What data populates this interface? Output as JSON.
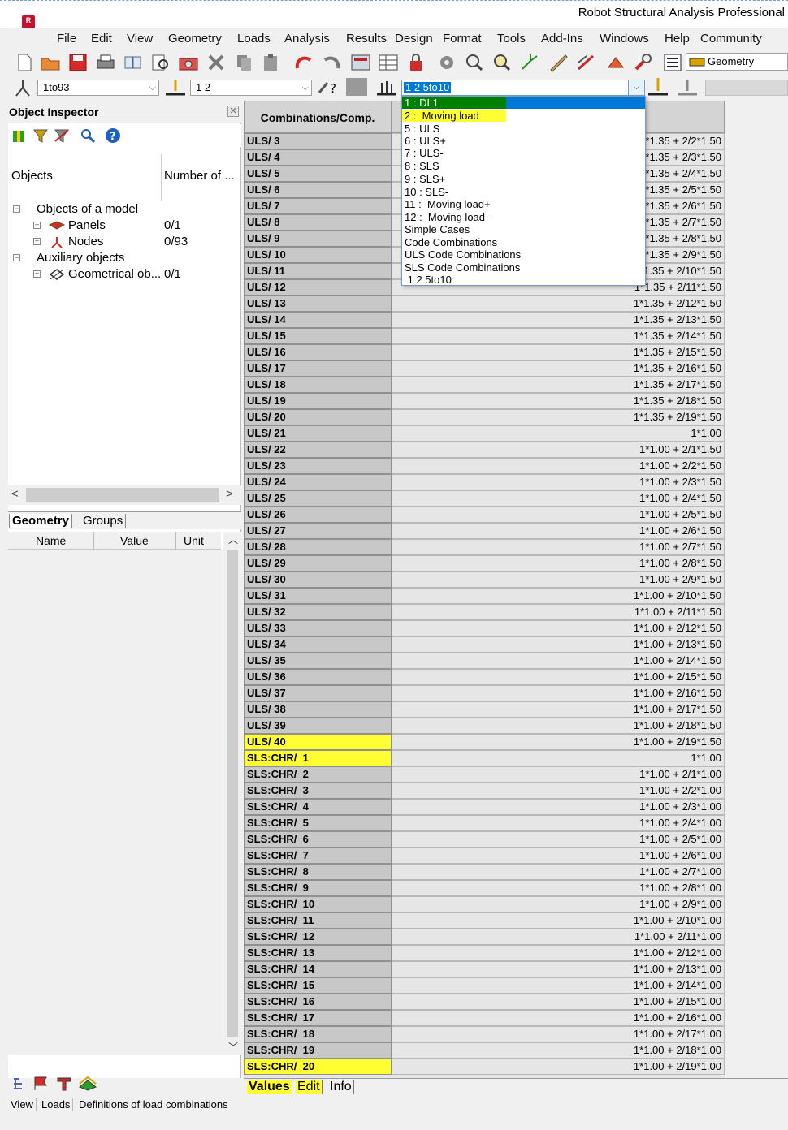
{
  "window": {
    "title": "Robot Structural Analysis Professional"
  },
  "menu": [
    "File",
    "Edit",
    "View",
    "Geometry",
    "Loads",
    "Analysis",
    "Results",
    "Design",
    "Format",
    "Tools",
    "Add-Ins",
    "Windows",
    "Help",
    "Community"
  ],
  "toolbar": {
    "layout_label": "Geometry"
  },
  "selectors": {
    "nodes_value": "1to93",
    "cases_value": "1 2",
    "combo_value": "1 2 5to10"
  },
  "inspector": {
    "title": "Object Inspector",
    "col_objects": "Objects",
    "col_number": "Number of ...",
    "tree": {
      "root": "Objects of a model",
      "panels": "Panels",
      "panels_count": "0/1",
      "nodes": "Nodes",
      "nodes_count": "0/93",
      "aux": "Auxiliary objects",
      "geom": "Geometrical ob...",
      "geom_count": "0/1"
    },
    "tabs": [
      "Geometry",
      "Groups"
    ],
    "props_cols": [
      "Name",
      "Value",
      "Unit"
    ]
  },
  "status": {
    "view": "View",
    "loads": "Loads",
    "message": "Definitions of load combinations"
  },
  "table": {
    "header": "Combinations/Comp.",
    "rows": [
      {
        "name": "ULS/ 3",
        "def": "1*1.35 + 2/2*1.50"
      },
      {
        "name": "ULS/ 4",
        "def": "1*1.35 + 2/3*1.50"
      },
      {
        "name": "ULS/ 5",
        "def": "1*1.35 + 2/4*1.50"
      },
      {
        "name": "ULS/ 6",
        "def": "1*1.35 + 2/5*1.50"
      },
      {
        "name": "ULS/ 7",
        "def": "1*1.35 + 2/6*1.50"
      },
      {
        "name": "ULS/ 8",
        "def": "1*1.35 + 2/7*1.50"
      },
      {
        "name": "ULS/ 9",
        "def": "1*1.35 + 2/8*1.50"
      },
      {
        "name": "ULS/ 10",
        "def": "1*1.35 + 2/9*1.50"
      },
      {
        "name": "ULS/ 11",
        "def": "1*1.35 + 2/10*1.50"
      },
      {
        "name": "ULS/ 12",
        "def": "1*1.35 + 2/11*1.50"
      },
      {
        "name": "ULS/ 13",
        "def": "1*1.35 + 2/12*1.50"
      },
      {
        "name": "ULS/ 14",
        "def": "1*1.35 + 2/13*1.50"
      },
      {
        "name": "ULS/ 15",
        "def": "1*1.35 + 2/14*1.50"
      },
      {
        "name": "ULS/ 16",
        "def": "1*1.35 + 2/15*1.50"
      },
      {
        "name": "ULS/ 17",
        "def": "1*1.35 + 2/16*1.50"
      },
      {
        "name": "ULS/ 18",
        "def": "1*1.35 + 2/17*1.50"
      },
      {
        "name": "ULS/ 19",
        "def": "1*1.35 + 2/18*1.50"
      },
      {
        "name": "ULS/ 20",
        "def": "1*1.35 + 2/19*1.50"
      },
      {
        "name": "ULS/ 21",
        "def": "1*1.00"
      },
      {
        "name": "ULS/ 22",
        "def": "1*1.00 + 2/1*1.50"
      },
      {
        "name": "ULS/ 23",
        "def": "1*1.00 + 2/2*1.50"
      },
      {
        "name": "ULS/ 24",
        "def": "1*1.00 + 2/3*1.50"
      },
      {
        "name": "ULS/ 25",
        "def": "1*1.00 + 2/4*1.50"
      },
      {
        "name": "ULS/ 26",
        "def": "1*1.00 + 2/5*1.50"
      },
      {
        "name": "ULS/ 27",
        "def": "1*1.00 + 2/6*1.50"
      },
      {
        "name": "ULS/ 28",
        "def": "1*1.00 + 2/7*1.50"
      },
      {
        "name": "ULS/ 29",
        "def": "1*1.00 + 2/8*1.50"
      },
      {
        "name": "ULS/ 30",
        "def": "1*1.00 + 2/9*1.50"
      },
      {
        "name": "ULS/ 31",
        "def": "1*1.00 + 2/10*1.50"
      },
      {
        "name": "ULS/ 32",
        "def": "1*1.00 + 2/11*1.50"
      },
      {
        "name": "ULS/ 33",
        "def": "1*1.00 + 2/12*1.50"
      },
      {
        "name": "ULS/ 34",
        "def": "1*1.00 + 2/13*1.50"
      },
      {
        "name": "ULS/ 35",
        "def": "1*1.00 + 2/14*1.50"
      },
      {
        "name": "ULS/ 36",
        "def": "1*1.00 + 2/15*1.50"
      },
      {
        "name": "ULS/ 37",
        "def": "1*1.00 + 2/16*1.50"
      },
      {
        "name": "ULS/ 38",
        "def": "1*1.00 + 2/17*1.50"
      },
      {
        "name": "ULS/ 39",
        "def": "1*1.00 + 2/18*1.50"
      },
      {
        "name": "ULS/ 40",
        "def": "1*1.00 + 2/19*1.50",
        "highlight": true
      },
      {
        "name": "SLS:CHR/  1",
        "def": "1*1.00",
        "highlight": true
      },
      {
        "name": "SLS:CHR/  2",
        "def": "1*1.00 + 2/1*1.00"
      },
      {
        "name": "SLS:CHR/  3",
        "def": "1*1.00 + 2/2*1.00"
      },
      {
        "name": "SLS:CHR/  4",
        "def": "1*1.00 + 2/3*1.00"
      },
      {
        "name": "SLS:CHR/  5",
        "def": "1*1.00 + 2/4*1.00"
      },
      {
        "name": "SLS:CHR/  6",
        "def": "1*1.00 + 2/5*1.00"
      },
      {
        "name": "SLS:CHR/  7",
        "def": "1*1.00 + 2/6*1.00"
      },
      {
        "name": "SLS:CHR/  8",
        "def": "1*1.00 + 2/7*1.00"
      },
      {
        "name": "SLS:CHR/  9",
        "def": "1*1.00 + 2/8*1.00"
      },
      {
        "name": "SLS:CHR/  10",
        "def": "1*1.00 + 2/9*1.00"
      },
      {
        "name": "SLS:CHR/  11",
        "def": "1*1.00 + 2/10*1.00"
      },
      {
        "name": "SLS:CHR/  12",
        "def": "1*1.00 + 2/11*1.00"
      },
      {
        "name": "SLS:CHR/  13",
        "def": "1*1.00 + 2/12*1.00"
      },
      {
        "name": "SLS:CHR/  14",
        "def": "1*1.00 + 2/13*1.00"
      },
      {
        "name": "SLS:CHR/  15",
        "def": "1*1.00 + 2/14*1.00"
      },
      {
        "name": "SLS:CHR/  16",
        "def": "1*1.00 + 2/15*1.00"
      },
      {
        "name": "SLS:CHR/  17",
        "def": "1*1.00 + 2/16*1.00"
      },
      {
        "name": "SLS:CHR/  18",
        "def": "1*1.00 + 2/17*1.00"
      },
      {
        "name": "SLS:CHR/  19",
        "def": "1*1.00 + 2/18*1.00"
      },
      {
        "name": "SLS:CHR/  20",
        "def": "1*1.00 + 2/19*1.00",
        "highlight": true
      }
    ]
  },
  "bottom_tabs": [
    "Values",
    "Edit",
    "Info"
  ],
  "dropdown": {
    "selected": "1 2 5to10",
    "items": [
      {
        "label": "1 : DL1",
        "state": "selected"
      },
      {
        "label": "2 :  Moving load",
        "state": "highlight"
      },
      {
        "label": "5 : ULS"
      },
      {
        "label": "6 : ULS+"
      },
      {
        "label": "7 : ULS-"
      },
      {
        "label": "8 : SLS"
      },
      {
        "label": "9 : SLS+"
      },
      {
        "label": "10 : SLS-"
      },
      {
        "label": "11 :  Moving load+"
      },
      {
        "label": "12 :  Moving load-"
      },
      {
        "label": "Simple Cases"
      },
      {
        "label": "Code Combinations"
      },
      {
        "label": "ULS Code Combinations"
      },
      {
        "label": "SLS Code Combinations"
      },
      {
        "label": " 1 2 5to10"
      }
    ]
  },
  "colors": {
    "highlight": "#ffff33",
    "selected_bg": "#0078d7",
    "selected_green": "#008000"
  }
}
